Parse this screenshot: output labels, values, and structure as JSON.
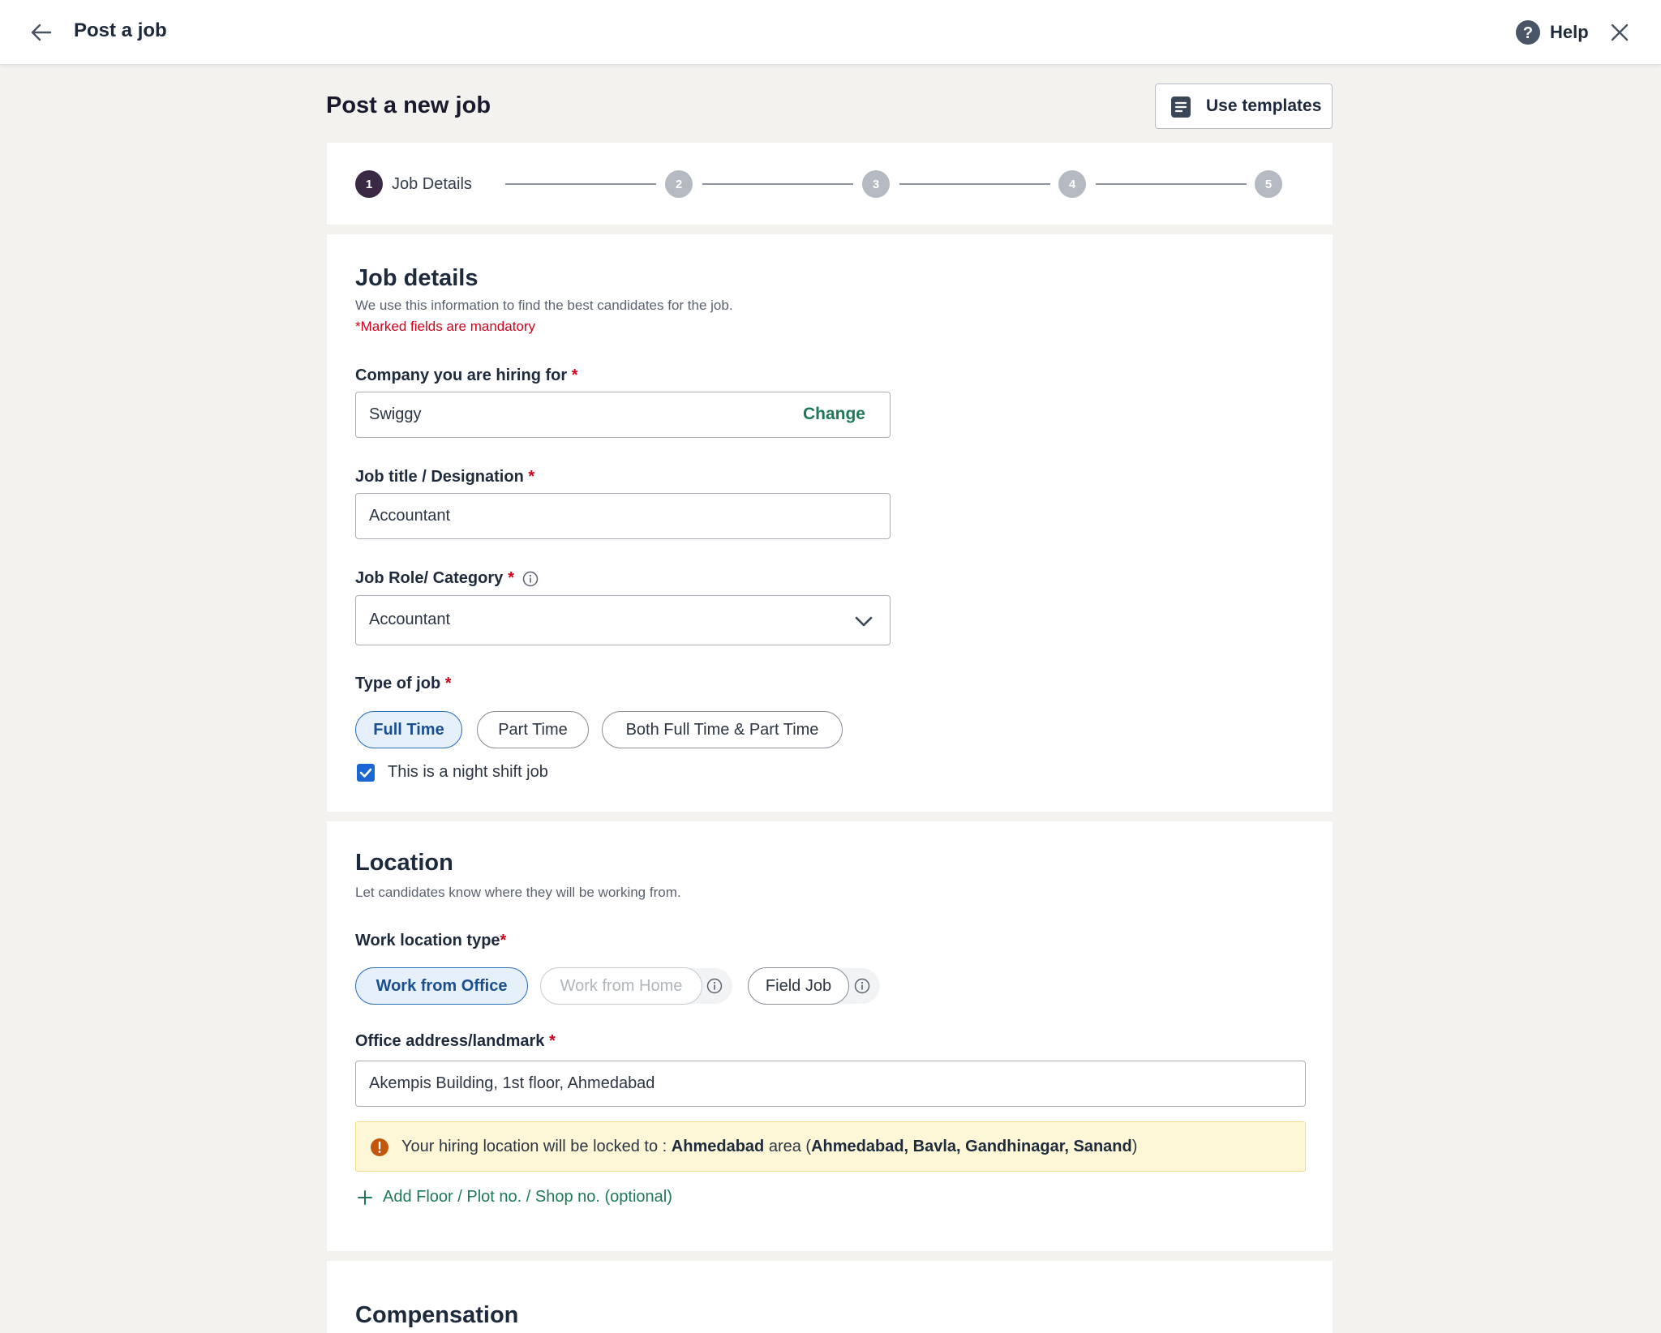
{
  "topbar": {
    "title": "Post a job",
    "help_label": "Help"
  },
  "header": {
    "page_title": "Post a new job",
    "templates_label": "Use templates"
  },
  "stepper": {
    "steps": [
      {
        "number": "1",
        "label": "Job Details"
      },
      {
        "number": "2"
      },
      {
        "number": "3"
      },
      {
        "number": "4"
      },
      {
        "number": "5"
      }
    ]
  },
  "job_details": {
    "title": "Job details",
    "subtitle": "We use this information to find the best candidates for the job.",
    "mandatory_note": "*Marked fields are mandatory",
    "company": {
      "label": "Company you are hiring for",
      "required": "*",
      "value": "Swiggy",
      "change_label": "Change"
    },
    "job_title": {
      "label": "Job title / Designation",
      "required": "*",
      "value": "Accountant"
    },
    "job_role": {
      "label": "Job Role/ Category",
      "required": "*",
      "value": "Accountant"
    },
    "job_type": {
      "label": "Type of job",
      "required": "*",
      "options": [
        "Full Time",
        "Part Time",
        "Both Full Time & Part Time"
      ],
      "selected": "Full Time"
    },
    "night_shift": {
      "label": "This is a night shift job",
      "checked": true
    }
  },
  "location": {
    "title": "Location",
    "subtitle": "Let candidates know where they will be working from.",
    "work_type": {
      "label": "Work location type",
      "required": "*",
      "options": [
        "Work from Office",
        "Work from Home",
        "Field Job"
      ],
      "selected": "Work from Office"
    },
    "address": {
      "label": "Office address/landmark",
      "required": "*",
      "value": "Akempis Building, 1st floor,  Ahmedabad"
    },
    "banner": {
      "prefix": "Your hiring location will be locked to : ",
      "city": "Ahmedabad",
      "middle": " area (",
      "areas": "Ahmedabad, Bavla, Gandhinagar, Sanand",
      "suffix": ")"
    },
    "add_floor_label": "Add Floor / Plot no. / Shop no. (optional)"
  },
  "compensation": {
    "title": "Compensation"
  },
  "colors": {
    "accent_green": "#1e7a55",
    "selected_blue": "#1a4f8f",
    "required_red": "#d0021b",
    "active_step": "#3b2845"
  }
}
